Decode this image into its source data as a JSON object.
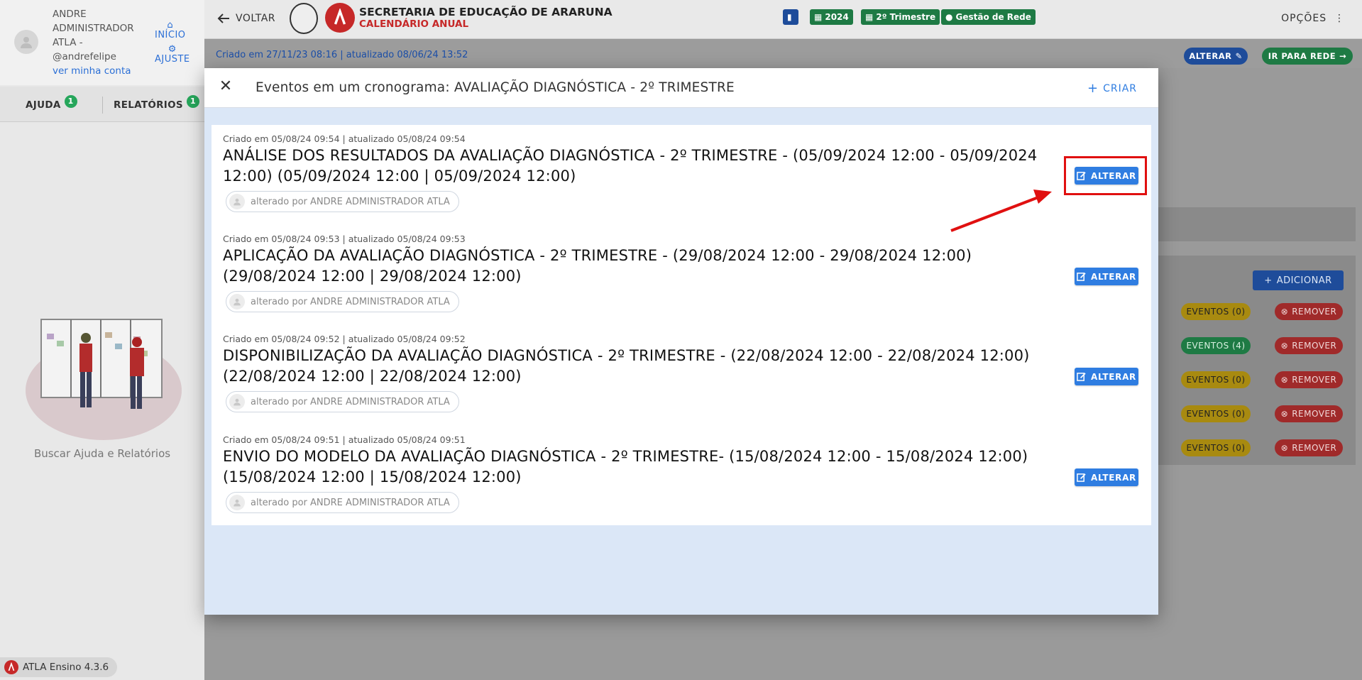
{
  "sidebar": {
    "user_name": "ANDRE ADMINISTRADOR ATLA - @andrefelipe",
    "account_link": "ver minha conta",
    "home_label": "INÍCIO",
    "settings_label": "AJUSTE",
    "tabs": [
      {
        "label": "AJUDA",
        "badge": "1"
      },
      {
        "label": "RELATÓRIOS",
        "badge": "1"
      }
    ],
    "help_caption": "Buscar Ajuda e Relatórios",
    "version": "ATLA Ensino 4.3.6"
  },
  "header": {
    "back_label": "VOLTAR",
    "title": "SECRETARIA DE EDUCAÇÃO DE ARARUNA",
    "subtitle": "CALENDÁRIO ANUAL",
    "chips": [
      "2024",
      "2º Trimestre",
      "Gestão de Rede"
    ],
    "options_label": "OPÇÕES"
  },
  "page": {
    "created_info": "Criado em 27/11/23 08:16 | atualizado 08/06/24 13:52",
    "alterar_label": "ALTERAR",
    "ir_para_rede_label": "IR PARA REDE",
    "adicionar_label": "ADICIONAR",
    "rows": [
      {
        "events": "EVENTOS (0)",
        "remove": "REMOVER"
      },
      {
        "events": "EVENTOS (4)",
        "remove": "REMOVER"
      },
      {
        "events": "EVENTOS (0)",
        "remove": "REMOVER"
      },
      {
        "events": "EVENTOS (0)",
        "remove": "REMOVER"
      },
      {
        "events": "EVENTOS (0)",
        "remove": "REMOVER"
      }
    ]
  },
  "modal": {
    "title": "Eventos em um cronograma: AVALIAÇÃO DIAGNÓSTICA - 2º TRIMESTRE",
    "create_label": "CRIAR",
    "edit_label": "ALTERAR",
    "events": [
      {
        "created": "Criado em 05/08/24 09:54 | atualizado 05/08/24 09:54",
        "title": "ANÁLISE DOS RESULTADOS DA AVALIAÇÃO DIAGNÓSTICA - 2º TRIMESTRE - (05/09/2024 12:00 - 05/09/2024 12:00) (05/09/2024 12:00 | 05/09/2024 12:00)",
        "changed_by": "alterado por ANDRE ADMINISTRADOR ATLA"
      },
      {
        "created": "Criado em 05/08/24 09:53 | atualizado 05/08/24 09:53",
        "title": "APLICAÇÃO DA AVALIAÇÃO DIAGNÓSTICA - 2º TRIMESTRE - (29/08/2024 12:00 - 29/08/2024 12:00) (29/08/2024 12:00 | 29/08/2024 12:00)",
        "changed_by": "alterado por ANDRE ADMINISTRADOR ATLA"
      },
      {
        "created": "Criado em 05/08/24 09:52 | atualizado 05/08/24 09:52",
        "title": "DISPONIBILIZAÇÃO DA AVALIAÇÃO DIAGNÓSTICA - 2º TRIMESTRE - (22/08/2024 12:00 - 22/08/2024 12:00) (22/08/2024 12:00 | 22/08/2024 12:00)",
        "changed_by": "alterado por ANDRE ADMINISTRADOR ATLA"
      },
      {
        "created": "Criado em 05/08/24 09:51 | atualizado 05/08/24 09:51",
        "title": "ENVIO DO MODELO DA AVALIAÇÃO DIAGNÓSTICA - 2º TRIMESTRE- (15/08/2024 12:00 - 15/08/2024 12:00) (15/08/2024 12:00 | 15/08/2024 12:00)",
        "changed_by": "alterado por ANDRE ADMINISTRADOR ATLA"
      }
    ]
  },
  "colors": {
    "primary": "#2f7de1",
    "success": "#26a65b",
    "danger": "#c62828",
    "highlight": "#e01010"
  }
}
